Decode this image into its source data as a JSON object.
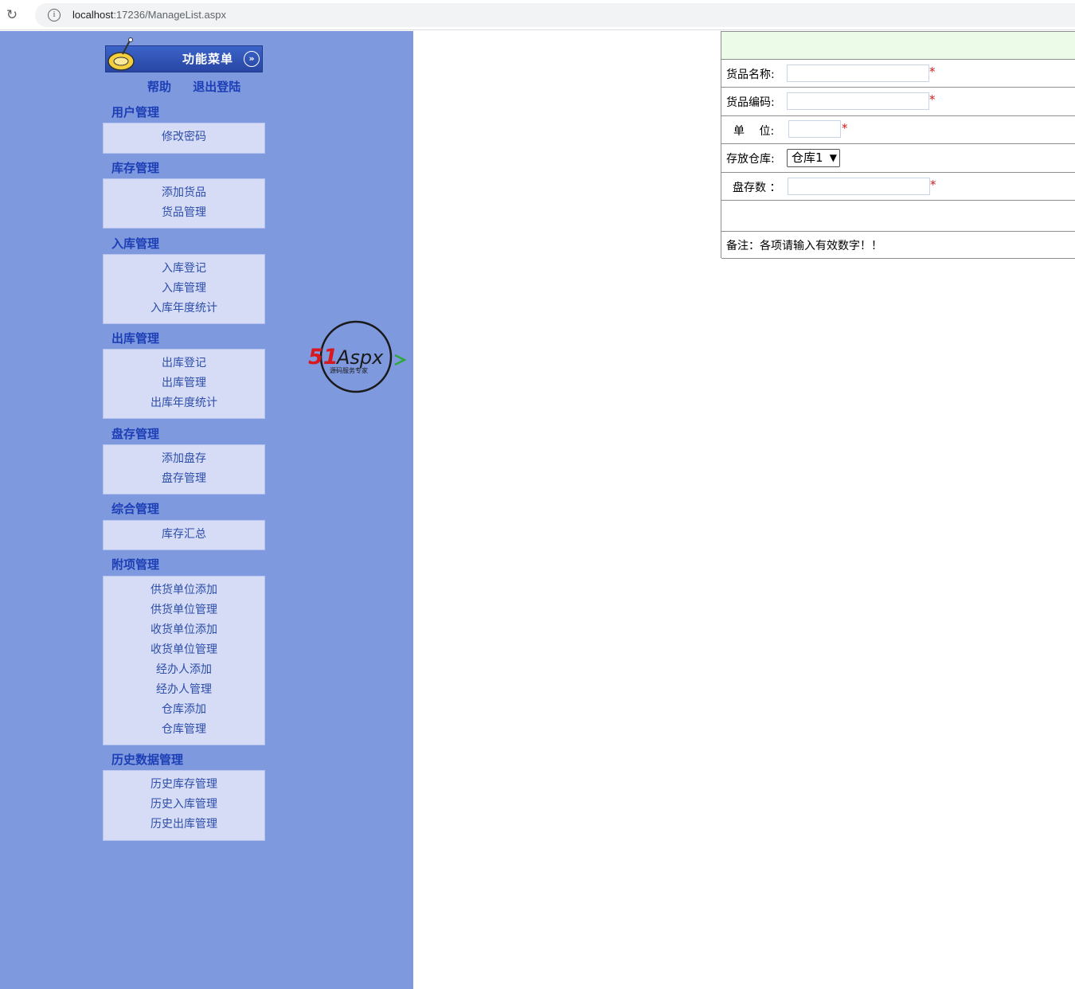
{
  "browser": {
    "url_host": "localhost",
    "url_rest": ":17236/ManageList.aspx",
    "reload_icon": "↻",
    "info_icon": "i"
  },
  "sidebar": {
    "title": "功能菜单",
    "collapse_icon": "»",
    "links": [
      "帮助",
      "退出登陆"
    ],
    "groups": [
      {
        "title": "用户管理",
        "items": [
          "修改密码"
        ]
      },
      {
        "title": "库存管理",
        "items": [
          "添加货品",
          "货品管理"
        ]
      },
      {
        "title": "入库管理",
        "items": [
          "入库登记",
          "入库管理",
          "入库年度统计"
        ]
      },
      {
        "title": "出库管理",
        "items": [
          "出库登记",
          "出库管理",
          "出库年度统计"
        ]
      },
      {
        "title": "盘存管理",
        "items": [
          "添加盘存",
          "盘存管理"
        ]
      },
      {
        "title": "综合管理",
        "items": [
          "库存汇总"
        ]
      },
      {
        "title": "附项管理",
        "items": [
          "供货单位添加",
          "供货单位管理",
          "收货单位添加",
          "收货单位管理",
          "经办人添加",
          "经办人管理",
          "仓库添加",
          "仓库管理"
        ]
      },
      {
        "title": "历史数据管理",
        "items": [
          "历史库存管理",
          "历史入库管理",
          "历史出库管理"
        ]
      }
    ]
  },
  "logo": {
    "text_51": "51",
    "text_aspx": "Aspx",
    "tagline": "源码服务专家"
  },
  "form": {
    "product_name_label": "货品名称:",
    "product_name_value": "",
    "product_code_label": "货品编码:",
    "product_code_value": "",
    "unit_label": "单　 位:",
    "unit_value": "",
    "warehouse_label": "存放仓库:",
    "warehouse_selected": "仓库1",
    "stock_label": "盘存数 ：",
    "stock_value": "",
    "required_mark": "*",
    "note": "备注：各项请输入有效数字！！"
  },
  "colors": {
    "sidebar_bg": "#7f99df",
    "group_box_bg": "#d6dcf6",
    "group_title": "#1d3fb5",
    "form_head_bg": "#ebfbe7",
    "required": "#c81e1e"
  }
}
